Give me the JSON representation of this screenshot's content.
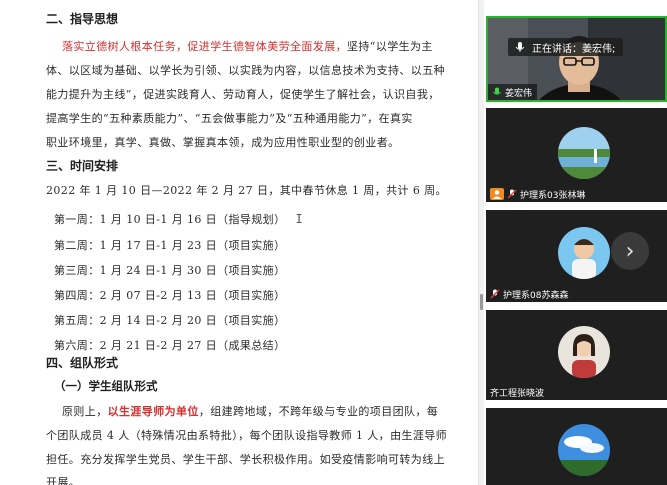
{
  "document": {
    "heading_2": "二、指导思想",
    "para1_red": "落实立德树人根本任务，促进学生德智体美劳全面发展，",
    "para1_rest": "坚持“以学生为主",
    "para1_l2": "体、以区域为基础、以学长为引领、以实践为内容，以信息技术为支持、以五种",
    "para1_l3": "能力提升为主线”，促进实践育人、劳动育人，促使学生了解社会，认识自我，",
    "para1_l4": "提高学生的“五种素质能力”、“五会做事能力”及“五种通用能力”，在真实",
    "para1_l5": "职业环境里，真学、真做、掌握真本领，成为应用性职业型的创业者。",
    "heading_3": "三、时间安排",
    "schedule_intro": "2022 年 1 月 10 日—2022 年 2 月 27 日，其中春节休息 1 周，共计 6 周。",
    "weeks": [
      "第一周：1 月 10 日-1 月 16 日（指导规划）",
      "第二周：1 月 17 日-1 月 23 日（项目实施）",
      "第三周：1 月 24 日-1 月 30 日（项目实施）",
      "第四周：2 月 07 日-2 月 13 日（项目实施）",
      "第五周：2 月 14 日-2 月 20 日（项目实施）",
      "第六周：2 月 21 日-2 月 27 日（成果总结）"
    ],
    "text_cursor": "I",
    "heading_4": "四、组队形式",
    "subheading_1": "（一）学生组队形式",
    "para2_l1_a": "原则上，",
    "para2_l1_red": "以生涯导师为单位",
    "para2_l1_b": "，组建跨地域，不跨年级与专业的项目团队，每",
    "para2_l2": "个团队成员 4 人（特殊情况由系特批），每个团队设指导教师 1 人，由生涯导师",
    "para2_l3": "担任。充分发挥学生党员、学生干部、学长积极作用。如受疫情影响可转为线上",
    "para2_l4": "开展。"
  },
  "meeting": {
    "speaking_label": "正在讲话：姜宏伟;",
    "participants": [
      {
        "name": "姜宏伟",
        "icon": "mic-on-icon"
      },
      {
        "name": "护理系03张林琳",
        "icon": "mic-muted-icon"
      },
      {
        "name": "护理系08苏森森",
        "icon": "mic-muted-icon"
      },
      {
        "name": "齐工程张晓波",
        "icon": ""
      },
      {
        "name": "",
        "icon": ""
      }
    ],
    "next_label": "›"
  },
  "colors": {
    "accent_red": "#d62f2f",
    "speaking_green": "#27b52b",
    "tile_bg": "#1f1f1f"
  }
}
